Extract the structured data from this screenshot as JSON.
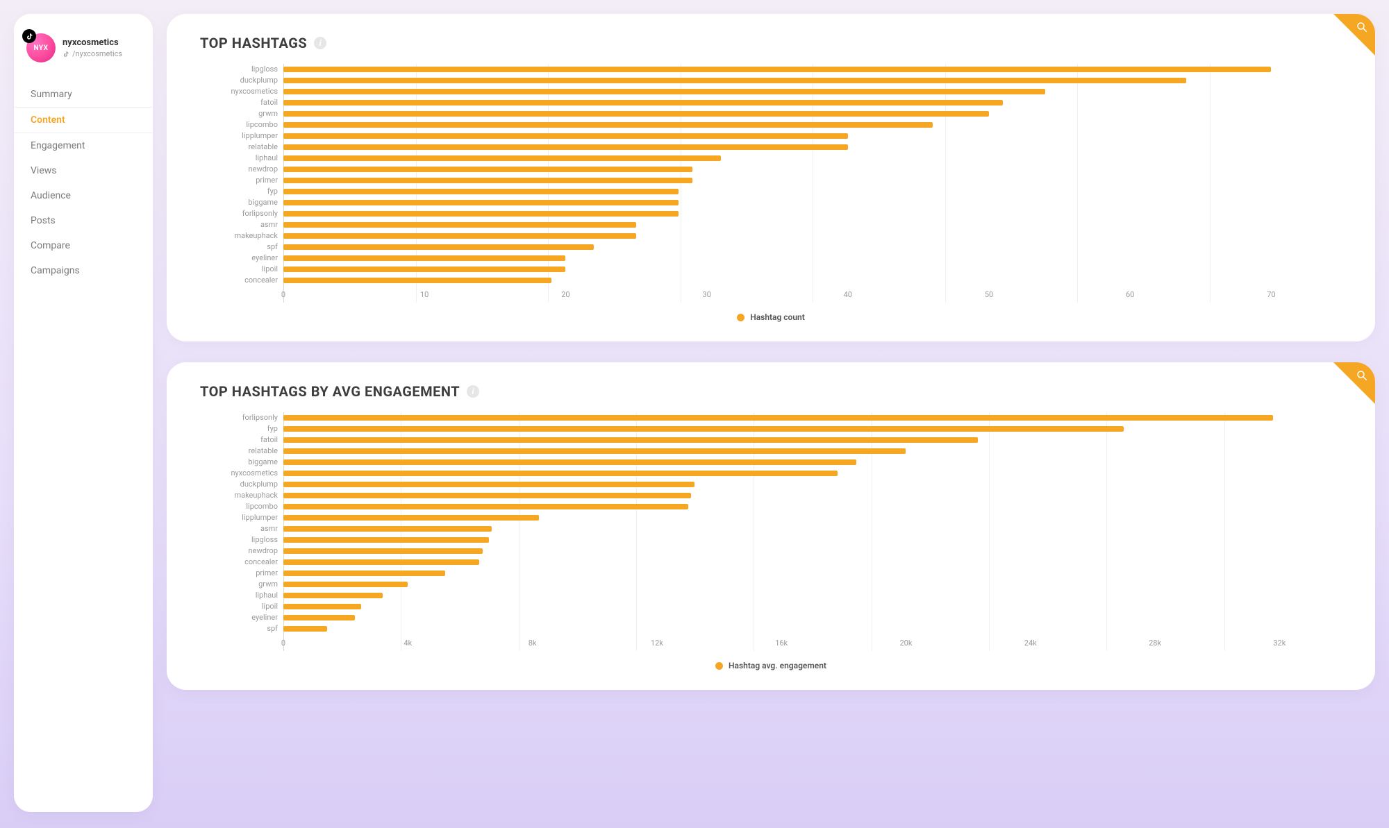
{
  "profile": {
    "name": "nyxcosmetics",
    "handle": "/nyxcosmetics",
    "avatar_text": "NYX"
  },
  "sidebar": {
    "items": [
      {
        "label": "Summary",
        "key": "summary"
      },
      {
        "label": "Content",
        "key": "content"
      },
      {
        "label": "Engagement",
        "key": "engagement"
      },
      {
        "label": "Views",
        "key": "views"
      },
      {
        "label": "Audience",
        "key": "audience"
      },
      {
        "label": "Posts",
        "key": "posts"
      },
      {
        "label": "Compare",
        "key": "compare"
      },
      {
        "label": "Campaigns",
        "key": "campaigns"
      }
    ],
    "active": "content"
  },
  "cards": [
    {
      "title": "TOP HASHTAGS",
      "legend": "Hashtag count"
    },
    {
      "title": "TOP HASHTAGS BY AVG ENGAGEMENT",
      "legend": "Hashtag avg. engagement"
    }
  ],
  "chart_data": [
    {
      "type": "bar",
      "orientation": "horizontal",
      "title": "TOP HASHTAGS",
      "xlabel": "",
      "ylabel": "",
      "xlim": [
        0,
        75
      ],
      "x_ticks": [
        0,
        10,
        20,
        30,
        40,
        50,
        60,
        70
      ],
      "x_tick_labels": [
        "0",
        "10",
        "20",
        "30",
        "40",
        "50",
        "60",
        "70"
      ],
      "legend": "Hashtag count",
      "categories": [
        "lipgloss",
        "duckplump",
        "nyxcosmetics",
        "fatoil",
        "grwm",
        "lipcombo",
        "lipplumper",
        "relatable",
        "liphaul",
        "newdrop",
        "primer",
        "fyp",
        "biggame",
        "forlipsonly",
        "asmr",
        "makeuphack",
        "spf",
        "eyeliner",
        "lipoil",
        "concealer"
      ],
      "values": [
        70,
        64,
        54,
        51,
        50,
        46,
        40,
        40,
        31,
        29,
        29,
        28,
        28,
        28,
        25,
        25,
        22,
        20,
        20,
        19
      ]
    },
    {
      "type": "bar",
      "orientation": "horizontal",
      "title": "TOP HASHTAGS BY AVG ENGAGEMENT",
      "xlabel": "",
      "ylabel": "",
      "xlim": [
        0,
        34000
      ],
      "x_ticks": [
        0,
        4000,
        8000,
        12000,
        16000,
        20000,
        24000,
        28000,
        32000
      ],
      "x_tick_labels": [
        "0",
        "4k",
        "8k",
        "12k",
        "16k",
        "20k",
        "24k",
        "28k",
        "32k"
      ],
      "legend": "Hashtag avg. engagement",
      "categories": [
        "forlipsonly",
        "fyp",
        "fatoil",
        "relatable",
        "biggame",
        "nyxcosmetics",
        "duckplump",
        "makeuphack",
        "lipcombo",
        "lipplumper",
        "asmr",
        "lipgloss",
        "newdrop",
        "concealer",
        "primer",
        "grwm",
        "liphaul",
        "lipoil",
        "eyeliner",
        "spf"
      ],
      "values": [
        31800,
        27000,
        22300,
        20000,
        18400,
        17800,
        13200,
        13100,
        13000,
        8200,
        6700,
        6600,
        6400,
        6300,
        5200,
        4000,
        3200,
        2500,
        2300,
        1400
      ]
    }
  ]
}
